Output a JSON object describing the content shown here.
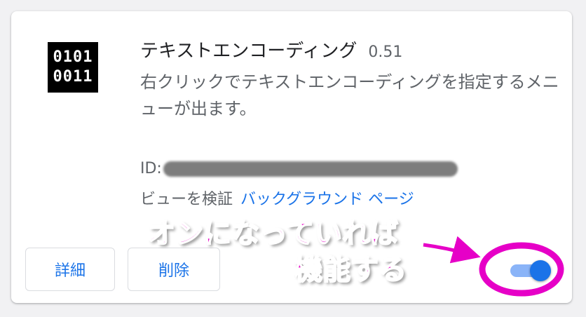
{
  "extension": {
    "icon_lines": [
      "0101",
      "0011"
    ],
    "name": "テキストエンコーディング",
    "version": "0.51",
    "description": "右クリックでテキストエンコーディングを指定するメニューが出ます。",
    "id_label": "ID:",
    "views_label": "ビューを検証",
    "background_page_link": "バックグラウンド ページ",
    "enabled": true
  },
  "buttons": {
    "details": "詳細",
    "remove": "削除"
  },
  "annotation": {
    "line1": "オンになっていれば",
    "line2": "機能する"
  },
  "colors": {
    "accent": "#1a73e8",
    "toggle_track": "#8ab4f8",
    "annotation": "#e600c7"
  }
}
